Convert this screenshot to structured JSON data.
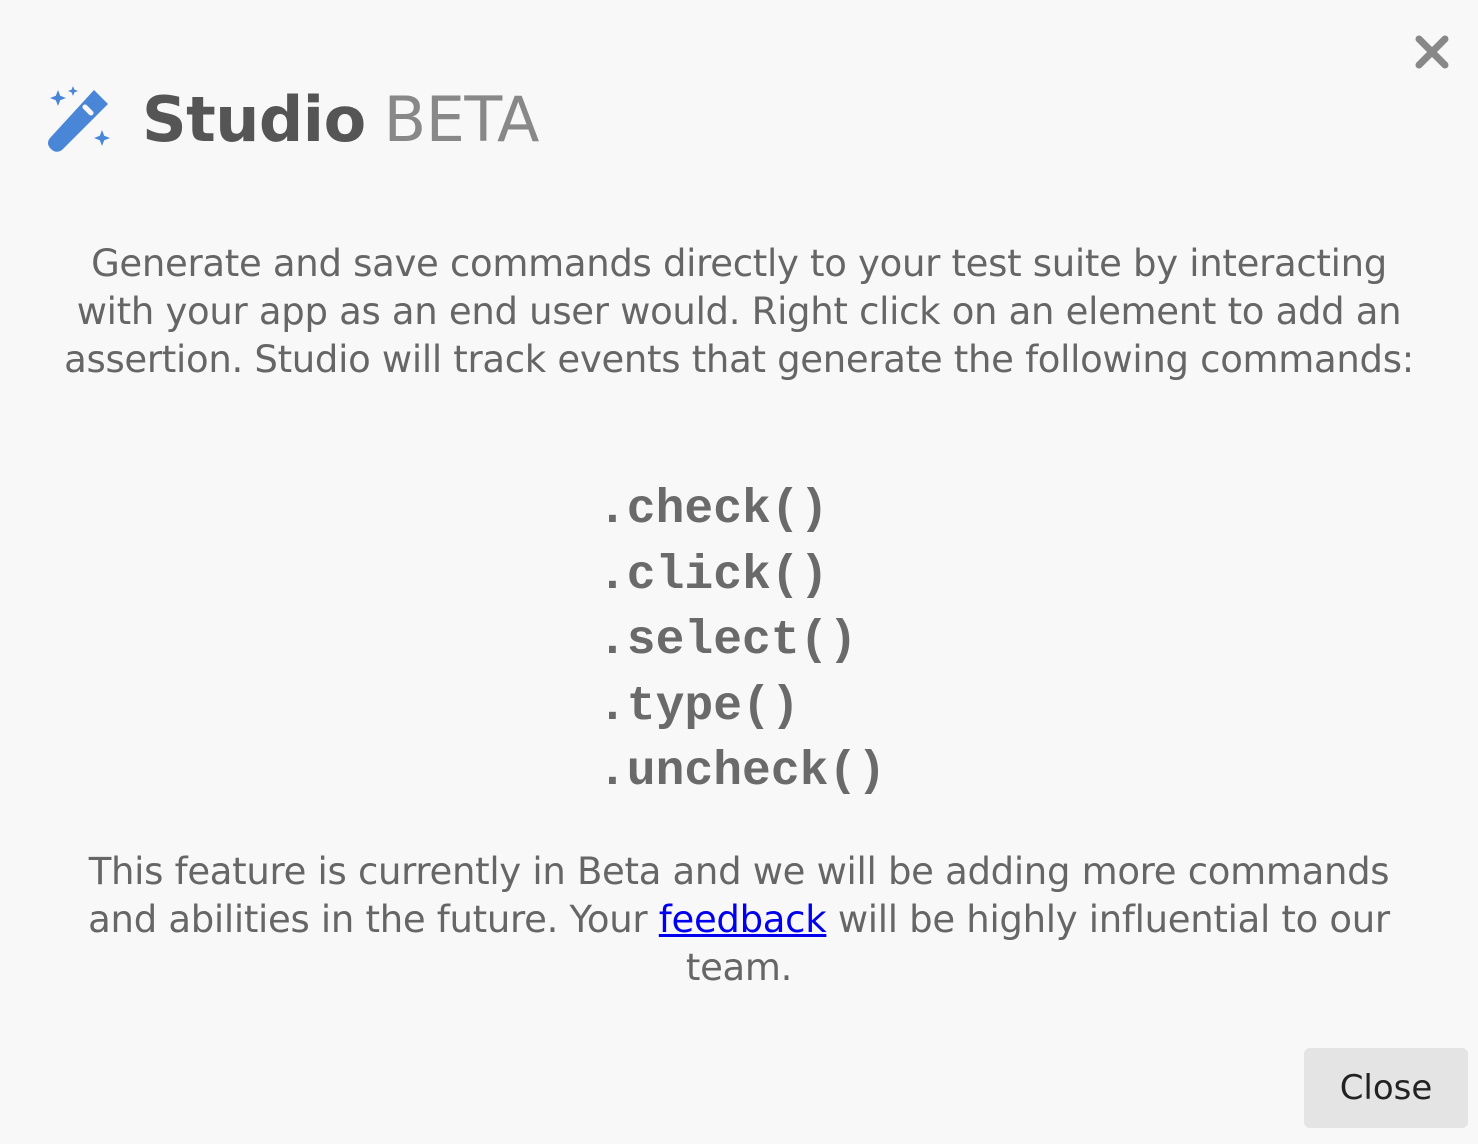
{
  "dialog": {
    "title": "Studio",
    "badge": "BETA",
    "intro": "Generate and save commands directly to your test suite by interacting with your app as an end user would. Right click on an element to add an assertion. Studio will track events that generate the following commands:",
    "commands": [
      ".check()",
      ".click()",
      ".select()",
      ".type()",
      ".uncheck()"
    ],
    "outro_before": "This feature is currently in Beta and we will be adding more commands and abilities in the future. Your ",
    "outro_link": "feedback",
    "outro_after": " will be highly influential to our team.",
    "close_label": "Close"
  },
  "icons": {
    "header": "magic-wand-icon",
    "dismiss": "close-icon"
  },
  "colors": {
    "background": "#f8f8f8",
    "accent": "#4a86d8",
    "title": "#555555",
    "badge": "#888888",
    "text": "#666666",
    "link": "#0000ee",
    "button": "#e4e4e4"
  }
}
